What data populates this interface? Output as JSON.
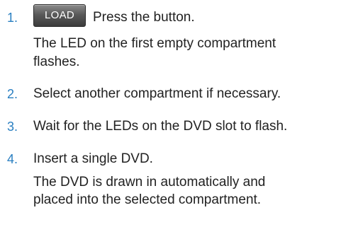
{
  "steps": [
    {
      "number": "1.",
      "button_label": "LOAD",
      "text": "Press the button.",
      "result_lines": [
        "The LED on the first empty compartment",
        "flashes."
      ]
    },
    {
      "number": "2.",
      "text": "Select another compartment if necessary."
    },
    {
      "number": "3.",
      "text": "Wait for the LEDs on the DVD slot to flash."
    },
    {
      "number": "4.",
      "text": "Insert a single DVD.",
      "result_lines": [
        "The DVD is drawn in automatically and",
        "placed into the selected compartment."
      ]
    }
  ],
  "colors": {
    "step_number": "#2a7fc1",
    "body_text": "#222222",
    "button_bg": "#4a4a4a"
  }
}
